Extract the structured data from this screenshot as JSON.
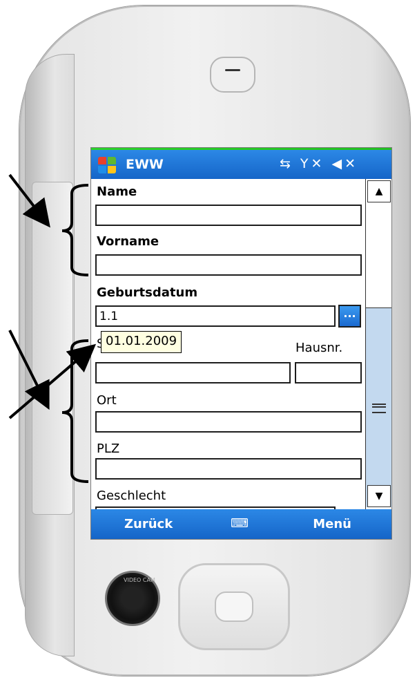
{
  "app": {
    "title": "EWW",
    "status_icons": "⇆ Y✕ ◀✕"
  },
  "form": {
    "name_label": "Name",
    "name_value": "",
    "vorname_label": "Vorname",
    "vorname_value": "",
    "geburtsdatum_label": "Geburtsdatum",
    "geburtsdatum_value": "1.1",
    "date_picker_label": "...",
    "tooltip_value": "01.01.2009",
    "strasse_label_partial": "S",
    "hausnr_label": "Hausnr.",
    "ort_label": "Ort",
    "plz_label": "PLZ",
    "geschlecht_label": "Geschlecht"
  },
  "scrollbar": {
    "up": "▲",
    "down": "▼"
  },
  "softkeys": {
    "left": "Zurück",
    "middle_icon": "keyboard-icon",
    "right": "Menü"
  },
  "device": {
    "camera_label": "VIDEO CAM"
  },
  "colors": {
    "titlebar": "#1a6fd4",
    "scroll_track": "#c3d9ef",
    "tooltip_bg": "#ffffe1",
    "button_blue": "#2a83e6"
  }
}
